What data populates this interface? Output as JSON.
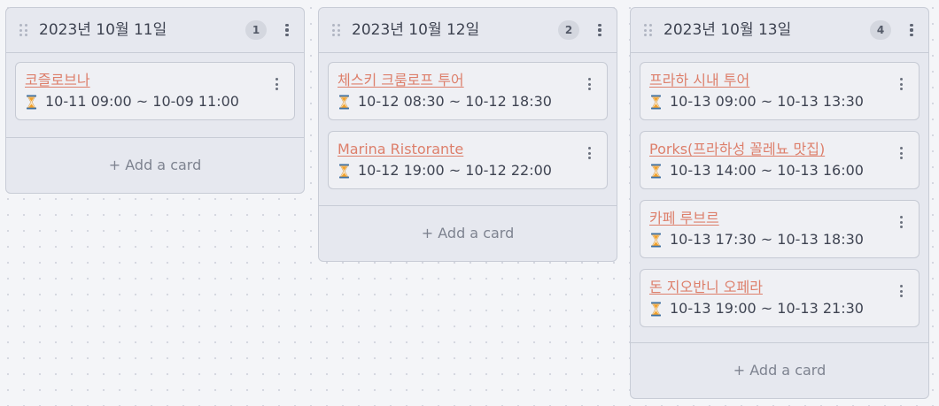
{
  "board": {
    "add_card_label": "+ Add a card",
    "columns": [
      {
        "title": "2023년 10월 11일",
        "count": "1",
        "cards": [
          {
            "title": "코즐로브나",
            "time": "10-11 09:00 ~ 10-09 11:00"
          }
        ]
      },
      {
        "title": "2023년 10월 12일",
        "count": "2",
        "cards": [
          {
            "title": "체스키 크룸로프 투어",
            "time": "10-12 08:30 ~ 10-12 18:30"
          },
          {
            "title": "Marina Ristorante",
            "time": "10-12 19:00 ~ 10-12 22:00"
          }
        ]
      },
      {
        "title": "2023년 10월 13일",
        "count": "4",
        "cards": [
          {
            "title": "프라하 시내 투어",
            "time": "10-13 09:00 ~ 10-13 13:30"
          },
          {
            "title": "Porks(프라하성 꼴레뇨 맛집)",
            "time": "10-13 14:00 ~ 10-13 16:00"
          },
          {
            "title": "카페 루브르",
            "time": "10-13 17:30 ~ 10-13 18:30"
          },
          {
            "title": "돈 지오반니 오페라",
            "time": "10-13 19:00 ~ 10-13 21:30"
          }
        ]
      }
    ]
  },
  "icons": {
    "drag": "drag-handle-icon",
    "menu": "kebab-menu-icon",
    "time": "hourglass-icon"
  },
  "colors": {
    "card_title": "#dd7f6b",
    "column_bg": "#e6e8ef",
    "card_bg": "#eff0f4",
    "hourglass_sand": "#f2a12a",
    "hourglass_frame": "#3f6f9e"
  }
}
